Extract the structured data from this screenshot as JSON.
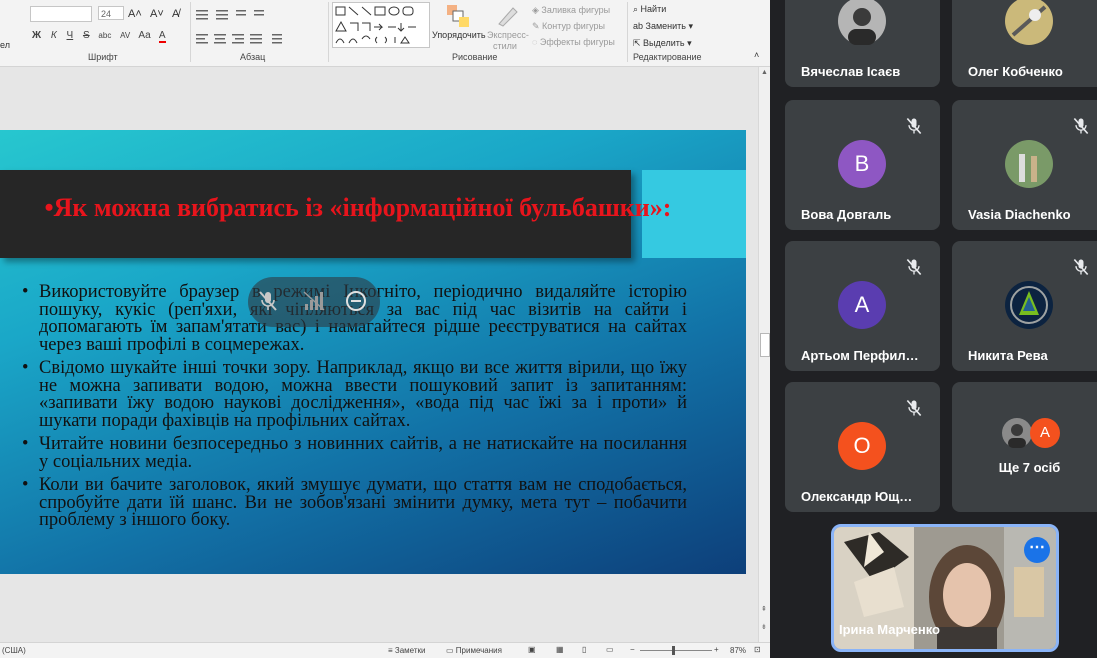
{
  "ribbon": {
    "font_size": "24",
    "groups": {
      "font": "Шрифт",
      "paragraph": "Абзац",
      "drawing": "Рисование",
      "editing": "Редактирование"
    },
    "drawing": {
      "arrange": "Упорядочить",
      "quick_styles_1": "Экспресс-",
      "quick_styles_2": "стили",
      "fill": "Заливка фигуры",
      "outline": "Контур фигуры",
      "effects": "Эффекты фигуры"
    },
    "editing": {
      "find": "Найти",
      "replace": "Заменить",
      "select": "Выделить"
    },
    "left_edge": "ел",
    "font_buttons": [
      "Ж",
      "К",
      "Ч",
      "S",
      "abc",
      "AV",
      "Aa",
      "A"
    ]
  },
  "slide": {
    "title": "•Як можна вибратись із «інформаційної бульбашки»:",
    "bullets": [
      "Використовуйте браузер в режимі Інкогніто, періодично видаляйте історію пошуку, кукіс (реп'яхи, які чіпляються за вас під час візитів на сайти і допомагають їм запам'ятати вас) і намагайтеся рідше реєструватися на сайтах через ваші профілі в соцмережах.",
      "Свідомо шукайте інші точки зору. Наприклад, якщо ви все життя вірили, що їжу не можна запивати водою, можна ввести пошуковий запит із запитанням: «запивати їжу водою наукові дослідження», «вода під час їжі за і проти» й шукати поради фахівців на профільних сайтах.",
      "Читайте новини безпосередньо з новинних сайтів, а не натискайте на посилання у соціальних медіа.",
      "Коли ви бачите заголовок, який змушує думати, що стаття вам не сподобається, спробуйте дати їй шанс. Ви не зобов'язані змінити думку, мета тут – побачити проблему з іншого боку."
    ]
  },
  "statusbar": {
    "lang": "(США)",
    "notes": "Заметки",
    "comments": "Примечания",
    "zoom": "87%"
  },
  "meet": {
    "participants": [
      {
        "name": "Вячеслав Ісаєв"
      },
      {
        "name": "Олег Кобченко"
      },
      {
        "name": "Вова Довгаль",
        "initial": "В",
        "color": "#8e57c3"
      },
      {
        "name": "Vasia Diachenko"
      },
      {
        "name": "Артьом Перфил…",
        "initial": "А",
        "color": "#5a3db0"
      },
      {
        "name": "Никита Рева"
      },
      {
        "name": "Олександр Ющ…",
        "initial": "О",
        "color": "#f4511e"
      },
      {
        "name": "Ще 7 осіб",
        "initial": "А",
        "color": "#f4511e"
      }
    ],
    "self_name": "Ірина Марченко"
  }
}
